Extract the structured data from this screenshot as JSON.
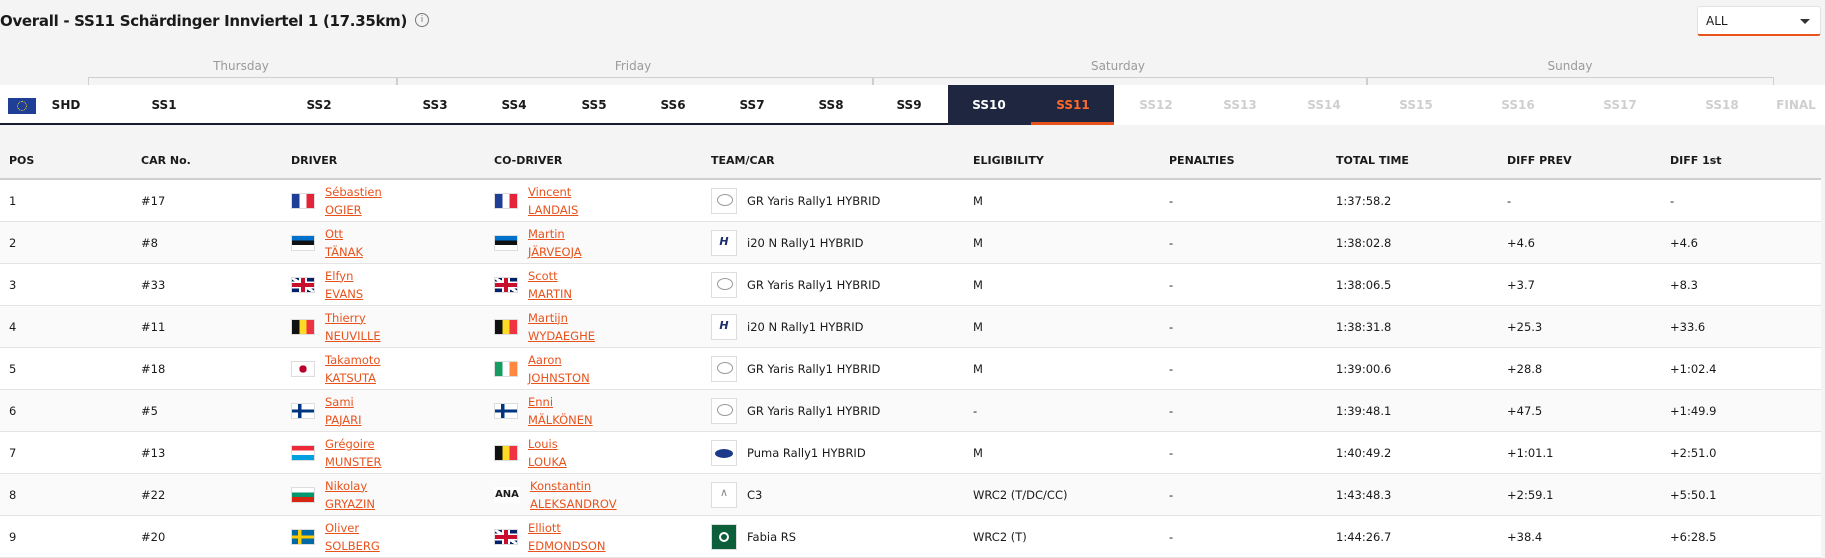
{
  "header": {
    "title": "Overall - SS11 Schärdinger Innviertel 1 (17.35km)",
    "info_icon": "info-circle-icon",
    "filter_value": "ALL",
    "accent_color": "#e8531d"
  },
  "days": [
    {
      "label": "Thursday"
    },
    {
      "label": "Friday"
    },
    {
      "label": "Saturday"
    },
    {
      "label": "Sunday"
    }
  ],
  "stages": [
    {
      "label": "SHD",
      "state": "done"
    },
    {
      "label": "SS1",
      "state": "done"
    },
    {
      "label": "SS2",
      "state": "done"
    },
    {
      "label": "SS3",
      "state": "done"
    },
    {
      "label": "SS4",
      "state": "done"
    },
    {
      "label": "SS5",
      "state": "done"
    },
    {
      "label": "SS6",
      "state": "done"
    },
    {
      "label": "SS7",
      "state": "done"
    },
    {
      "label": "SS8",
      "state": "done"
    },
    {
      "label": "SS9",
      "state": "done"
    },
    {
      "label": "SS10",
      "state": "done"
    },
    {
      "label": "SS11",
      "state": "current"
    },
    {
      "label": "SS12",
      "state": "disabled"
    },
    {
      "label": "SS13",
      "state": "disabled"
    },
    {
      "label": "SS14",
      "state": "disabled"
    },
    {
      "label": "SS15",
      "state": "disabled"
    },
    {
      "label": "SS16",
      "state": "disabled"
    },
    {
      "label": "SS17",
      "state": "disabled"
    },
    {
      "label": "SS18",
      "state": "disabled"
    },
    {
      "label": "FINAL",
      "state": "disabled"
    }
  ],
  "table": {
    "columns": [
      "POS",
      "CAR No.",
      "DRIVER",
      "CO-DRIVER",
      "TEAM/CAR",
      "ELIGIBILITY",
      "PENALTIES",
      "TOTAL TIME",
      "DIFF PREV",
      "DIFF 1st"
    ],
    "rows": [
      {
        "pos": "1",
        "car": "#17",
        "driver_flag": "france",
        "driver_first": "Sébastien",
        "driver_last": "OGIER",
        "co_flag": "france",
        "co_first": "Vincent",
        "co_last": "LANDAIS",
        "logo": "toyota",
        "team": "GR Yaris Rally1 HYBRID",
        "elig": "M",
        "pen": "-",
        "total": "1:37:58.2",
        "diff_prev": "-",
        "diff_first": "-"
      },
      {
        "pos": "2",
        "car": "#8",
        "driver_flag": "estonia",
        "driver_first": "Ott",
        "driver_last": "TÄNAK",
        "co_flag": "estonia",
        "co_first": "Martin",
        "co_last": "JÄRVEOJA",
        "logo": "hyundai",
        "team": "i20 N Rally1 HYBRID",
        "elig": "M",
        "pen": "-",
        "total": "1:38:02.8",
        "diff_prev": "+4.6",
        "diff_first": "+4.6"
      },
      {
        "pos": "3",
        "car": "#33",
        "driver_flag": "uk",
        "driver_first": "Elfyn",
        "driver_last": "EVANS",
        "co_flag": "uk",
        "co_first": "Scott",
        "co_last": "MARTIN",
        "logo": "toyota",
        "team": "GR Yaris Rally1 HYBRID",
        "elig": "M",
        "pen": "-",
        "total": "1:38:06.5",
        "diff_prev": "+3.7",
        "diff_first": "+8.3"
      },
      {
        "pos": "4",
        "car": "#11",
        "driver_flag": "belgium",
        "driver_first": "Thierry",
        "driver_last": "NEUVILLE",
        "co_flag": "belgium",
        "co_first": "Martijn",
        "co_last": "WYDAEGHE",
        "logo": "hyundai",
        "team": "i20 N Rally1 HYBRID",
        "elig": "M",
        "pen": "-",
        "total": "1:38:31.8",
        "diff_prev": "+25.3",
        "diff_first": "+33.6"
      },
      {
        "pos": "5",
        "car": "#18",
        "driver_flag": "japan",
        "driver_first": "Takamoto",
        "driver_last": "KATSUTA",
        "co_flag": "ireland",
        "co_first": "Aaron",
        "co_last": "JOHNSTON",
        "logo": "toyota",
        "team": "GR Yaris Rally1 HYBRID",
        "elig": "M",
        "pen": "-",
        "total": "1:39:00.6",
        "diff_prev": "+28.8",
        "diff_first": "+1:02.4"
      },
      {
        "pos": "6",
        "car": "#5",
        "driver_flag": "finland",
        "driver_first": "Sami",
        "driver_last": "PAJARI",
        "co_flag": "finland",
        "co_first": "Enni",
        "co_last": "MÄLKÖNEN",
        "logo": "toyota",
        "team": "GR Yaris Rally1 HYBRID",
        "elig": "-",
        "pen": "-",
        "total": "1:39:48.1",
        "diff_prev": "+47.5",
        "diff_first": "+1:49.9"
      },
      {
        "pos": "7",
        "car": "#13",
        "driver_flag": "luxembourg",
        "driver_first": "Grégoire",
        "driver_last": "MUNSTER",
        "co_flag": "belgium",
        "co_first": "Louis",
        "co_last": "LOUKA",
        "logo": "ford",
        "team": "Puma Rally1 HYBRID",
        "elig": "M",
        "pen": "-",
        "total": "1:40:49.2",
        "diff_prev": "+1:01.1",
        "diff_first": "+2:51.0"
      },
      {
        "pos": "8",
        "car": "#22",
        "driver_flag": "bulgaria",
        "driver_first": "Nikolay",
        "driver_last": "GRYAZIN",
        "co_flag": "ana",
        "co_flag_text": "ANA",
        "co_first": "Konstantin",
        "co_last": "ALEKSANDROV",
        "logo": "citroen",
        "team": "C3",
        "elig": "WRC2 (T/DC/CC)",
        "pen": "-",
        "total": "1:43:48.3",
        "diff_prev": "+2:59.1",
        "diff_first": "+5:50.1"
      },
      {
        "pos": "9",
        "car": "#20",
        "driver_flag": "sweden",
        "driver_first": "Oliver",
        "driver_last": "SOLBERG",
        "co_flag": "uk",
        "co_first": "Elliott",
        "co_last": "EDMONDSON",
        "logo": "skoda",
        "team": "Fabia RS",
        "elig": "WRC2 (T)",
        "pen": "-",
        "total": "1:44:26.7",
        "diff_prev": "+38.4",
        "diff_first": "+6:28.5"
      }
    ]
  }
}
